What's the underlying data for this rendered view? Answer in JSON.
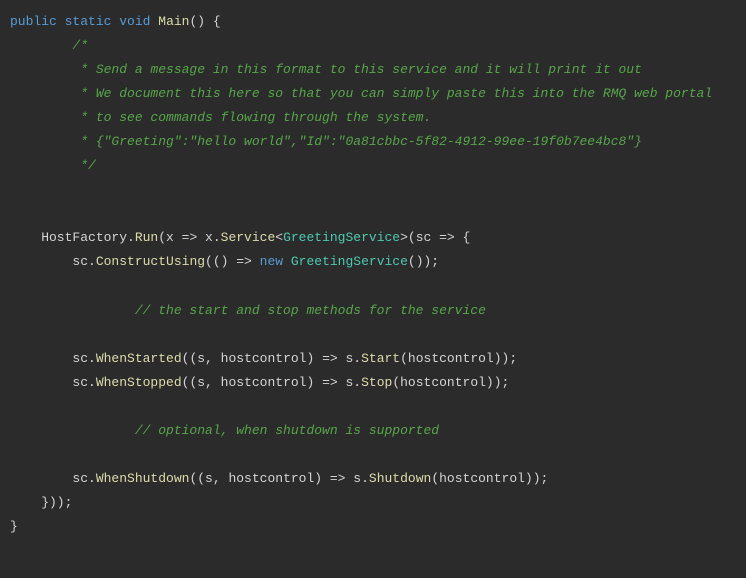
{
  "code": {
    "line1": {
      "kw_public": "public",
      "kw_static": "static",
      "kw_void": "void",
      "method_main": "Main",
      "tail": "() {"
    },
    "comment_block": {
      "l1": "        /*",
      "l2": "         * Send a message in this format to this service and it will print it out",
      "l3": "         * We document this here so that you can simply paste this into the RMQ web portal",
      "l4": "         * to see commands flowing through the system.",
      "l5": "         * {\"Greeting\":\"hello world\",\"Id\":\"0a81cbbc-5f82-4912-99ee-19f0b7ee4bc8\"}",
      "l6": "         */"
    },
    "hostfactory": {
      "pre": "    HostFactory.",
      "run": "Run",
      "mid1": "(x => x.",
      "service": "Service",
      "lt": "<",
      "type": "GreetingService",
      "gt": ">(sc => {"
    },
    "construct": {
      "pre": "        sc.",
      "method": "ConstructUsing",
      "mid": "(() => ",
      "new": "new",
      "sp": " ",
      "type": "GreetingService",
      "tail": "());"
    },
    "comment_startstop": "                // the start and stop methods for the service",
    "whenstarted": {
      "pre": "        sc.",
      "method": "WhenStarted",
      "mid": "((s, hostcontrol) => s.",
      "call": "Start",
      "tail": "(hostcontrol));"
    },
    "whenstopped": {
      "pre": "        sc.",
      "method": "WhenStopped",
      "mid": "((s, hostcontrol) => s.",
      "call": "Stop",
      "tail": "(hostcontrol));"
    },
    "comment_optional": "                // optional, when shutdown is supported",
    "whenshutdown": {
      "pre": "        sc.",
      "method": "WhenShutdown",
      "mid": "((s, hostcontrol) => s.",
      "call": "Shutdown",
      "tail": "(hostcontrol));"
    },
    "close1": "    }));",
    "close2": "}"
  }
}
